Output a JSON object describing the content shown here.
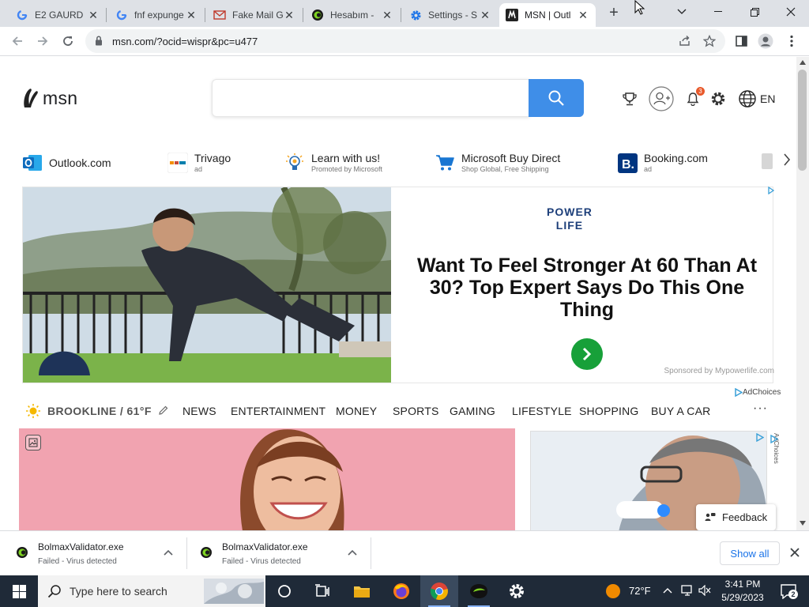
{
  "browser": {
    "tabs": [
      {
        "title": "E2 GAURD",
        "favicon": "google-g-icon",
        "active": false
      },
      {
        "title": "fnf expunge",
        "favicon": "google-g-icon",
        "active": false
      },
      {
        "title": "Fake Mail G",
        "favicon": "mail-envelope-icon",
        "active": false
      },
      {
        "title": "Hesabım -",
        "favicon": "green-circle-icon",
        "active": false
      },
      {
        "title": "Settings - S",
        "favicon": "gear-icon",
        "active": false
      },
      {
        "title": "MSN | Outl",
        "favicon": "msn-icon",
        "active": true
      }
    ],
    "new_tab_symbol": "+",
    "url": "msn.com/?ocid=wispr&pc=u477"
  },
  "msn": {
    "logo_text": "msn",
    "search_placeholder": "",
    "notification_count": "3",
    "language": "EN",
    "quick_links": [
      {
        "name": "Outlook.com",
        "sub": "",
        "icon": "outlook-icon"
      },
      {
        "name": "Trivago",
        "sub": "ad",
        "icon": "trivago-icon"
      },
      {
        "name": "Learn with us!",
        "sub": "Promoted by Microsoft",
        "icon": "lightbulb-icon"
      },
      {
        "name": "Microsoft Buy Direct",
        "sub": "Shop Global, Free Shipping",
        "icon": "shopping-cart-icon"
      },
      {
        "name": "Booking.com",
        "sub": "ad",
        "icon": "booking-icon"
      }
    ],
    "ad": {
      "brand_line1": "POWER",
      "brand_line2": "LIFE",
      "headline": "Want To Feel Stronger At 60 Than At 30? Top Expert Says Do This One Thing",
      "sponsor": "Sponsored by Mypowerlife.com",
      "adchoices": "AdChoices"
    },
    "weather": {
      "location": "BROOKLINE / 61°F"
    },
    "nav": [
      "NEWS",
      "ENTERTAINMENT",
      "MONEY",
      "SPORTS",
      "GAMING",
      "LIFESTYLE",
      "SHOPPING",
      "BUY A CAR"
    ],
    "nav_more": "···",
    "side_adchoices": "AdChoices",
    "feedback_label": "Feedback"
  },
  "downloads": {
    "items": [
      {
        "name": "BolmaxValidator.exe",
        "status": "Failed - Virus detected"
      },
      {
        "name": "BolmaxValidator.exe",
        "status": "Failed - Virus detected"
      }
    ],
    "show_all": "Show all"
  },
  "taskbar": {
    "search_placeholder": "Type here to search",
    "temperature": "72°F",
    "time": "3:41 PM",
    "date": "5/29/2023",
    "notification_count": "2"
  },
  "colors": {
    "tab_strip": "#dee1e6",
    "msn_search_blue": "#3f8ee8",
    "ad_go_green": "#17a039",
    "hero_pink": "#f0a4b1",
    "taskbar": "#1f2a38"
  }
}
